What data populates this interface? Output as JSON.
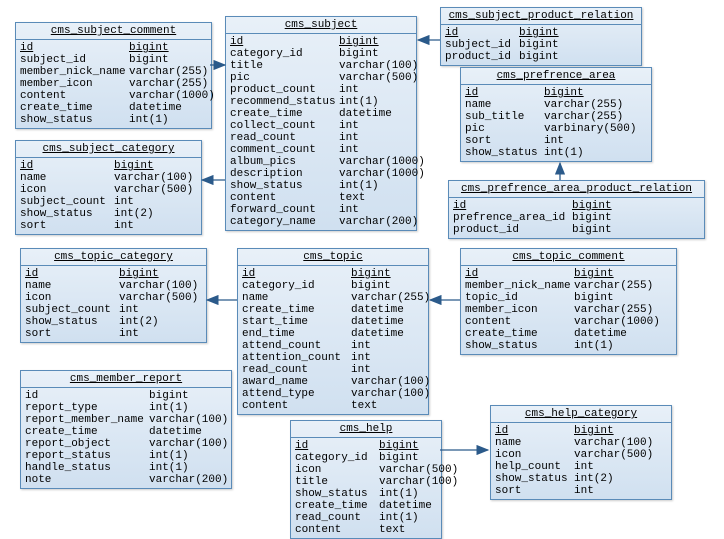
{
  "tables": {
    "subject_comment": {
      "title": "cms_subject_comment",
      "cols": [
        {
          "n": "id",
          "t": "bigint",
          "k": "<pk>",
          "u": 1
        },
        {
          "n": "subject_id",
          "t": "bigint",
          "k": "<fk>"
        },
        {
          "n": "member_nick_name",
          "t": "varchar(255)"
        },
        {
          "n": "member_icon",
          "t": "varchar(255)"
        },
        {
          "n": "content",
          "t": "varchar(1000)"
        },
        {
          "n": "create_time",
          "t": "datetime"
        },
        {
          "n": "show_status",
          "t": "int(1)"
        }
      ]
    },
    "subject": {
      "title": "cms_subject",
      "cols": [
        {
          "n": "id",
          "t": "bigint",
          "k": "<pk>",
          "u": 1
        },
        {
          "n": "category_id",
          "t": "bigint",
          "k": "<fk>"
        },
        {
          "n": "title",
          "t": "varchar(100)"
        },
        {
          "n": "pic",
          "t": "varchar(500)"
        },
        {
          "n": "product_count",
          "t": "int"
        },
        {
          "n": "recommend_status",
          "t": "int(1)"
        },
        {
          "n": "create_time",
          "t": "datetime"
        },
        {
          "n": "collect_count",
          "t": "int"
        },
        {
          "n": "read_count",
          "t": "int"
        },
        {
          "n": "comment_count",
          "t": "int"
        },
        {
          "n": "album_pics",
          "t": "varchar(1000)"
        },
        {
          "n": "description",
          "t": "varchar(1000)"
        },
        {
          "n": "show_status",
          "t": "int(1)"
        },
        {
          "n": "content",
          "t": "text"
        },
        {
          "n": "forward_count",
          "t": "int"
        },
        {
          "n": "category_name",
          "t": "varchar(200)"
        }
      ]
    },
    "subject_prod_rel": {
      "title": "cms_subject_product_relation",
      "cols": [
        {
          "n": "id",
          "t": "bigint",
          "k": "<pk>",
          "u": 1
        },
        {
          "n": "subject_id",
          "t": "bigint",
          "k": "<fk>"
        },
        {
          "n": "product_id",
          "t": "bigint"
        }
      ]
    },
    "pref_area": {
      "title": "cms_prefrence_area",
      "cols": [
        {
          "n": "id",
          "t": "bigint",
          "k": "<pk>",
          "u": 1
        },
        {
          "n": "name",
          "t": "varchar(255)"
        },
        {
          "n": "sub_title",
          "t": "varchar(255)"
        },
        {
          "n": "pic",
          "t": "varbinary(500)"
        },
        {
          "n": "sort",
          "t": "int"
        },
        {
          "n": "show_status",
          "t": "int(1)"
        }
      ]
    },
    "subject_cat": {
      "title": "cms_subject_category",
      "cols": [
        {
          "n": "id",
          "t": "bigint",
          "k": "<pk>",
          "u": 1
        },
        {
          "n": "name",
          "t": "varchar(100)"
        },
        {
          "n": "icon",
          "t": "varchar(500)"
        },
        {
          "n": "subject_count",
          "t": "int"
        },
        {
          "n": "show_status",
          "t": "int(2)"
        },
        {
          "n": "sort",
          "t": "int"
        }
      ]
    },
    "pref_area_prod_rel": {
      "title": "cms_prefrence_area_product_relation",
      "cols": [
        {
          "n": "id",
          "t": "bigint",
          "k": "<pk>",
          "u": 1
        },
        {
          "n": "prefrence_area_id",
          "t": "bigint",
          "k": "<fk>"
        },
        {
          "n": "product_id",
          "t": "bigint"
        }
      ]
    },
    "topic_cat": {
      "title": "cms_topic_category",
      "cols": [
        {
          "n": "id",
          "t": "bigint",
          "k": "<pk>",
          "u": 1
        },
        {
          "n": "name",
          "t": "varchar(100)"
        },
        {
          "n": "icon",
          "t": "varchar(500)"
        },
        {
          "n": "subject_count",
          "t": "int"
        },
        {
          "n": "show_status",
          "t": "int(2)"
        },
        {
          "n": "sort",
          "t": "int"
        }
      ]
    },
    "topic": {
      "title": "cms_topic",
      "cols": [
        {
          "n": "id",
          "t": "bigint",
          "k": "<pk>",
          "u": 1
        },
        {
          "n": "category_id",
          "t": "bigint",
          "k": "<fk>"
        },
        {
          "n": "name",
          "t": "varchar(255)"
        },
        {
          "n": "create_time",
          "t": "datetime"
        },
        {
          "n": "start_time",
          "t": "datetime"
        },
        {
          "n": "end_time",
          "t": "datetime"
        },
        {
          "n": "attend_count",
          "t": "int"
        },
        {
          "n": "attention_count",
          "t": "int"
        },
        {
          "n": "read_count",
          "t": "int"
        },
        {
          "n": "award_name",
          "t": "varchar(100)"
        },
        {
          "n": "attend_type",
          "t": "varchar(100)"
        },
        {
          "n": "content",
          "t": "text"
        }
      ]
    },
    "topic_comment": {
      "title": "cms_topic_comment",
      "cols": [
        {
          "n": "id",
          "t": "bigint",
          "k": "<pk>",
          "u": 1
        },
        {
          "n": "member_nick_name",
          "t": "varchar(255)"
        },
        {
          "n": "topic_id",
          "t": "bigint"
        },
        {
          "n": "member_icon",
          "t": "varchar(255)"
        },
        {
          "n": "content",
          "t": "varchar(1000)"
        },
        {
          "n": "create_time",
          "t": "datetime"
        },
        {
          "n": "show_status",
          "t": "int(1)"
        }
      ]
    },
    "member_report": {
      "title": "cms_member_report",
      "cols": [
        {
          "n": "id",
          "t": "bigint"
        },
        {
          "n": "report_type",
          "t": "int(1)"
        },
        {
          "n": "report_member_name",
          "t": "varchar(100)"
        },
        {
          "n": "create_time",
          "t": "datetime"
        },
        {
          "n": "report_object",
          "t": "varchar(100)"
        },
        {
          "n": "report_status",
          "t": "int(1)"
        },
        {
          "n": "handle_status",
          "t": "int(1)"
        },
        {
          "n": "note",
          "t": "varchar(200)"
        }
      ]
    },
    "help": {
      "title": "cms_help",
      "cols": [
        {
          "n": "id",
          "t": "bigint",
          "k": "<pk>",
          "u": 1
        },
        {
          "n": "category_id",
          "t": "bigint",
          "k": "<fk>"
        },
        {
          "n": "icon",
          "t": "varchar(500)"
        },
        {
          "n": "title",
          "t": "varchar(100)"
        },
        {
          "n": "show_status",
          "t": "int(1)"
        },
        {
          "n": "create_time",
          "t": "datetime"
        },
        {
          "n": "read_count",
          "t": "int(1)"
        },
        {
          "n": "content",
          "t": "text"
        }
      ]
    },
    "help_cat": {
      "title": "cms_help_category",
      "cols": [
        {
          "n": "id",
          "t": "bigint",
          "k": "<pk>",
          "u": 1
        },
        {
          "n": "name",
          "t": "varchar(100)"
        },
        {
          "n": "icon",
          "t": "varchar(500)"
        },
        {
          "n": "help_count",
          "t": "int"
        },
        {
          "n": "show_status",
          "t": "int(2)"
        },
        {
          "n": "sort",
          "t": "int"
        }
      ]
    }
  },
  "chart_data": {
    "type": "table",
    "description": "Entity-relationship diagram with 12 tables",
    "relations": [
      {
        "from": "cms_subject_comment",
        "to": "cms_subject",
        "via": "subject_id"
      },
      {
        "from": "cms_subject_product_relation",
        "to": "cms_subject",
        "via": "subject_id"
      },
      {
        "from": "cms_subject",
        "to": "cms_subject_category",
        "via": "category_id"
      },
      {
        "from": "cms_prefrence_area_product_relation",
        "to": "cms_prefrence_area",
        "via": "prefrence_area_id"
      },
      {
        "from": "cms_topic",
        "to": "cms_topic_category",
        "via": "category_id"
      },
      {
        "from": "cms_topic_comment",
        "to": "cms_topic",
        "via": "topic_id"
      },
      {
        "from": "cms_help",
        "to": "cms_help_category",
        "via": "category_id"
      }
    ]
  }
}
